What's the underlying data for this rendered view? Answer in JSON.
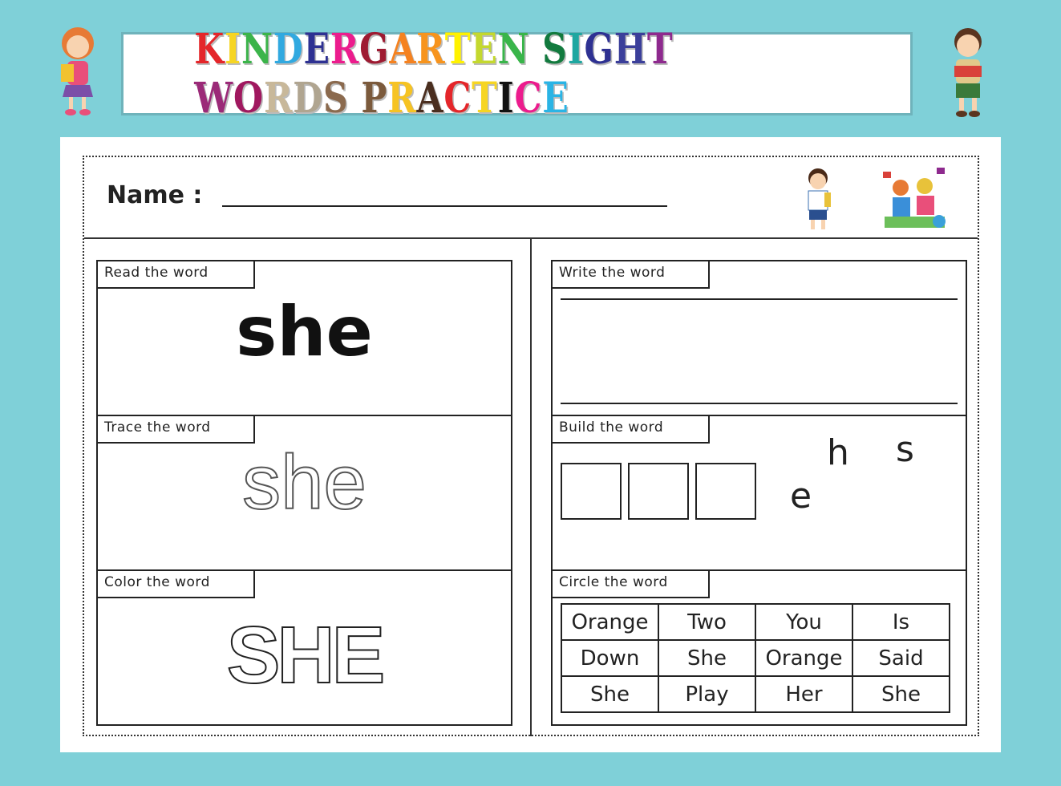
{
  "title": {
    "text": "KINDERGARTEN SIGHT WORDS PRACTICE",
    "colors": [
      "#e4262a",
      "#f6d523",
      "#3bb44a",
      "#31a9e0",
      "#2e3192",
      "#ec1c8d",
      "#9e1b32",
      "#f58220",
      "#f7941d",
      "#fff200",
      "#c4d82e",
      "#39b54a",
      " ",
      "#127a3e",
      "#1fa7a0",
      "#2e3192",
      "#3b3f9a",
      "#8e2a8e",
      " ",
      "#9b2a78",
      "#a0185f",
      "#c8b89a",
      "#b0a590",
      "#8b6a4e",
      " ",
      "#7b5a3c",
      "#f6c323",
      "#4a2e1f",
      "#e4262a",
      "#f6d523",
      "#111111",
      "#ec1c8d",
      "#2ab4e5"
    ]
  },
  "worksheet": {
    "name_label": "Name :",
    "read": {
      "label": "Read the word",
      "word": "she"
    },
    "trace": {
      "label": "Trace the word",
      "word": "she"
    },
    "color": {
      "label": "Color the word",
      "word": "SHE"
    },
    "write": {
      "label": "Write the word"
    },
    "build": {
      "label": "Build the word",
      "letters": [
        "e",
        "h",
        "s"
      ]
    },
    "circle": {
      "label": "Circle the word",
      "rows": [
        [
          "Orange",
          "Two",
          "You",
          "Is"
        ],
        [
          "Down",
          "She",
          "Orange",
          "Said"
        ],
        [
          "She",
          "Play",
          "Her",
          "She"
        ]
      ]
    }
  }
}
